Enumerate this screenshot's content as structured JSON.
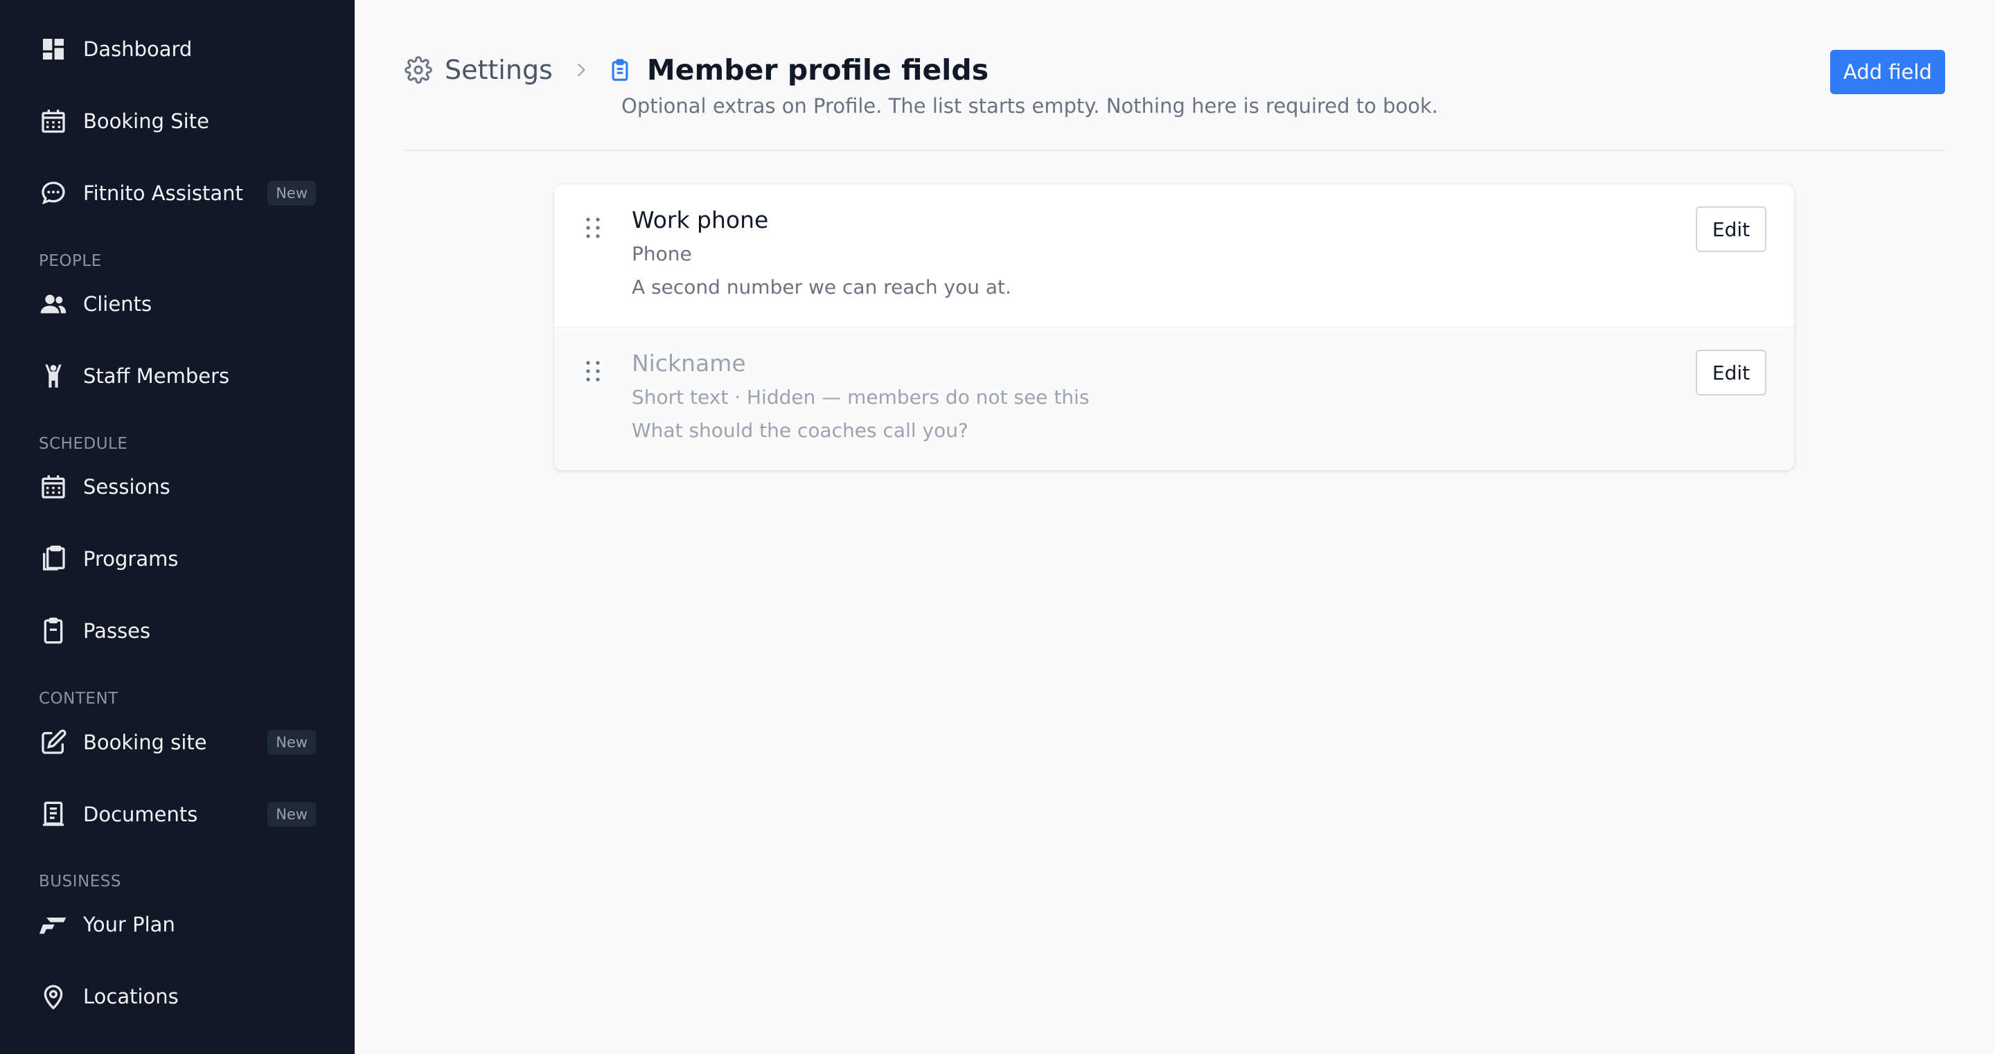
{
  "sidebar": {
    "items": [
      {
        "label": "Dashboard",
        "icon": "dashboard-icon"
      },
      {
        "label": "Booking Site",
        "icon": "calendar-icon"
      },
      {
        "label": "Fitnito Assistant",
        "icon": "chat-icon",
        "badge": "New"
      },
      {
        "label": "Clients",
        "icon": "users-icon"
      },
      {
        "label": "Staff Members",
        "icon": "person-icon"
      },
      {
        "label": "Sessions",
        "icon": "calendar-icon"
      },
      {
        "label": "Programs",
        "icon": "clipboard-stack-icon"
      },
      {
        "label": "Passes",
        "icon": "pass-icon"
      },
      {
        "label": "Booking site",
        "icon": "edit-icon",
        "badge": "New"
      },
      {
        "label": "Documents",
        "icon": "document-icon",
        "badge": "New"
      },
      {
        "label": "Your Plan",
        "icon": "brand-logo-icon"
      },
      {
        "label": "Locations",
        "icon": "map-pin-icon"
      }
    ],
    "sections": {
      "people": "PEOPLE",
      "schedule": "SCHEDULE",
      "content": "CONTENT",
      "business": "BUSINESS"
    }
  },
  "header": {
    "breadcrumb_parent": "Settings",
    "title": "Member profile fields",
    "subtitle": "Optional extras on Profile. The list starts empty. Nothing here is required to book.",
    "add_button": "Add field"
  },
  "fields": [
    {
      "name": "Work phone",
      "meta": "Phone",
      "help": "A second number we can reach you at.",
      "hidden": false,
      "edit_label": "Edit"
    },
    {
      "name": "Nickname",
      "meta": "Short text · Hidden — members do not see this",
      "help": "What should the coaches call you?",
      "hidden": true,
      "edit_label": "Edit"
    }
  ],
  "colors": {
    "sidebar_bg": "#111827",
    "accent": "#2f7cf6",
    "page_bg": "#f8f9fb"
  }
}
